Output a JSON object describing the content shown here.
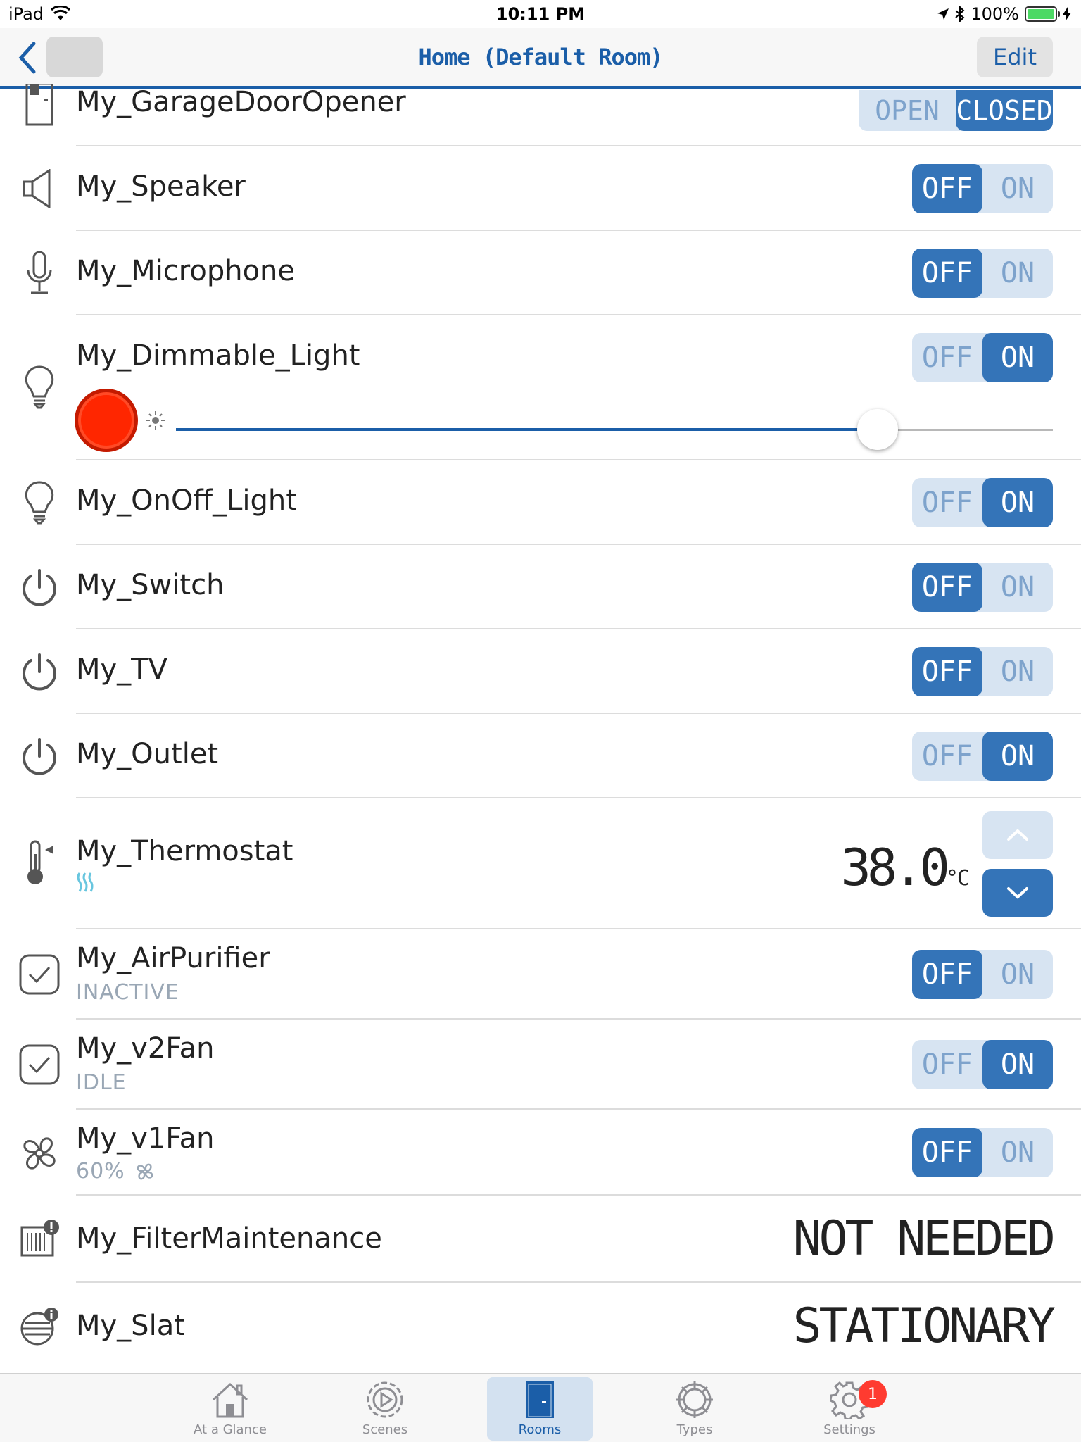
{
  "status_bar": {
    "device": "iPad",
    "time": "10:11 PM",
    "battery": "100%"
  },
  "nav": {
    "title": "Home (Default Room)",
    "edit_label": "Edit"
  },
  "devices": [
    {
      "name": "My_GarageDoorOpener",
      "icon": "garage-door-icon",
      "control": "open-closed",
      "option_a": "OPEN",
      "option_b": "CLOSED",
      "state": "CLOSED"
    },
    {
      "name": "My_Speaker",
      "icon": "speaker-icon",
      "control": "toggle",
      "off": "OFF",
      "on": "ON",
      "state": "OFF"
    },
    {
      "name": "My_Microphone",
      "icon": "microphone-icon",
      "control": "toggle",
      "off": "OFF",
      "on": "ON",
      "state": "OFF"
    },
    {
      "name": "My_Dimmable_Light",
      "icon": "lightbulb-icon",
      "control": "toggle",
      "off": "OFF",
      "on": "ON",
      "state": "ON",
      "brightness_fraction": 0.8,
      "color": "#ff2600"
    },
    {
      "name": "My_OnOff_Light",
      "icon": "lightbulb-icon",
      "control": "toggle",
      "off": "OFF",
      "on": "ON",
      "state": "ON"
    },
    {
      "name": "My_Switch",
      "icon": "power-icon",
      "control": "toggle",
      "off": "OFF",
      "on": "ON",
      "state": "OFF"
    },
    {
      "name": "My_TV",
      "icon": "power-icon",
      "control": "toggle",
      "off": "OFF",
      "on": "ON",
      "state": "OFF"
    },
    {
      "name": "My_Outlet",
      "icon": "power-icon",
      "control": "toggle",
      "off": "OFF",
      "on": "ON",
      "state": "ON"
    },
    {
      "name": "My_Thermostat",
      "icon": "thermometer-icon",
      "control": "stepper",
      "value": "38.0",
      "unit": "°C",
      "mode_icon": "heating-icon"
    },
    {
      "name": "My_AirPurifier",
      "icon": "checkbox-icon",
      "subtitle": "INACTIVE",
      "control": "toggle",
      "off": "OFF",
      "on": "ON",
      "state": "OFF"
    },
    {
      "name": "My_v2Fan",
      "icon": "checkbox-icon",
      "subtitle": "IDLE",
      "control": "toggle",
      "off": "OFF",
      "on": "ON",
      "state": "ON"
    },
    {
      "name": "My_v1Fan",
      "icon": "fan-icon",
      "subtitle": "60%",
      "control": "toggle",
      "off": "OFF",
      "on": "ON",
      "state": "OFF"
    },
    {
      "name": "My_FilterMaintenance",
      "icon": "filter-alert-icon",
      "control": "readout",
      "value": "NOT NEEDED"
    },
    {
      "name": "My_Slat",
      "icon": "slat-info-icon",
      "control": "readout",
      "value": "STATIONARY"
    }
  ],
  "tabs": [
    {
      "label": "At a Glance",
      "icon": "house-icon",
      "active": false
    },
    {
      "label": "Scenes",
      "icon": "scenes-play-icon",
      "active": false
    },
    {
      "label": "Rooms",
      "icon": "door-icon",
      "active": true
    },
    {
      "label": "Types",
      "icon": "types-ring-icon",
      "active": false
    },
    {
      "label": "Settings",
      "icon": "gear-icon",
      "active": false,
      "badge": "1"
    }
  ],
  "colors": {
    "accent": "#1b5ea8",
    "toggle_active": "#3474b8",
    "toggle_inactive": "#d7e4f2",
    "badge": "#ff3b30"
  }
}
